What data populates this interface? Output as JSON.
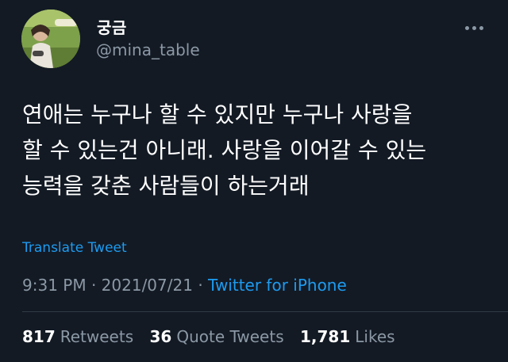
{
  "author": {
    "display_name": "궁금",
    "handle": "@mina_table",
    "avatar_icon": "profile-photo"
  },
  "tweet": {
    "text": "연애는 누구나 할 수 있지만 누구나 사랑을\n할 수 있는건 아니래. 사랑을 이어갈 수 있는\n능력을 갖춘 사람들이 하는거래",
    "translate_label": "Translate Tweet",
    "time": "9:31 PM",
    "separator": "·",
    "date": "2021/07/21",
    "source": "Twitter for iPhone"
  },
  "stats": {
    "retweets_count": "817",
    "retweets_label": "Retweets",
    "quotes_count": "36",
    "quotes_label": "Quote Tweets",
    "likes_count": "1,781",
    "likes_label": "Likes"
  },
  "colors": {
    "background": "#131a24",
    "link": "#1d9bf0",
    "muted": "#8b98a5",
    "text": "#ffffff"
  },
  "icons": {
    "more": "more-dots-icon"
  }
}
